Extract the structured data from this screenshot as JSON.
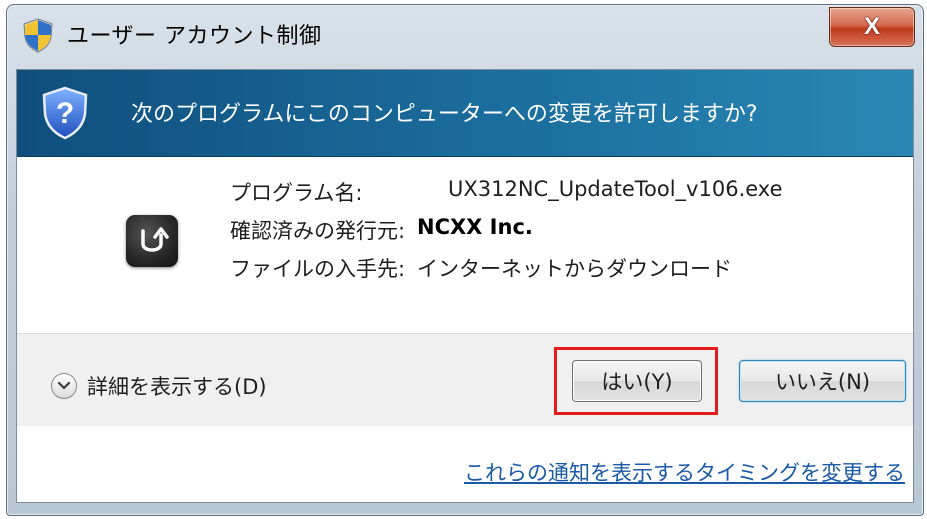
{
  "window": {
    "title": "ユーザー アカウント制御",
    "close_label": "X"
  },
  "banner": {
    "question": "次のプログラムにこのコンピューターへの変更を許可しますか?"
  },
  "details": {
    "program_name_label": "プログラム名:",
    "program_name_value": "UX312NC_UpdateTool_v106.exe",
    "publisher_label": "確認済みの発行元:",
    "publisher_value": "NCXX Inc.",
    "source_label": "ファイルの入手先:",
    "source_value": "インターネットからダウンロード"
  },
  "actions": {
    "details_toggle": "詳細を表示する(D)",
    "yes_label": "はい(Y)",
    "no_label": "いいえ(N)"
  },
  "footer": {
    "link": "これらの通知を表示するタイミングを変更する"
  },
  "icons": [
    "uac-shield-icon",
    "help-shield-icon",
    "app-update-icon",
    "chevron-down-icon"
  ],
  "colors": {
    "banner": "#1b6e9e",
    "highlight": "#e11c1c",
    "close": "#c0391b",
    "link": "#1a5aa6"
  }
}
